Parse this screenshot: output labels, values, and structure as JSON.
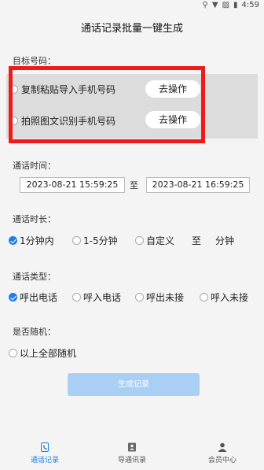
{
  "status_bar": {
    "time": "4:59"
  },
  "title": "通话记录批量一键生成",
  "target": {
    "label": "目标号码：",
    "options": [
      {
        "label": "复制粘贴导入手机号码",
        "button": "去操作"
      },
      {
        "label": "拍照图文识别手机号码",
        "button": "去操作"
      }
    ]
  },
  "time_section": {
    "label": "通话时间：",
    "start": "2023-08-21 15:59:25",
    "separator": "至",
    "end": "2023-08-21 16:59:25"
  },
  "duration": {
    "label": "通话时长：",
    "options": [
      "1分钟内",
      "1-5分钟",
      "自定义"
    ],
    "custom_to": "至",
    "custom_unit": "分钟",
    "selected": 0
  },
  "call_type": {
    "label": "通话类型：",
    "options": [
      "呼出电话",
      "呼入电话",
      "呼出未接",
      "呼入未接"
    ],
    "selected": 0
  },
  "random": {
    "label": "是否随机：",
    "option": "以上全部随机"
  },
  "generate_button": "生成记录",
  "tabs": [
    {
      "label": "通话记录",
      "icon": "phone-icon",
      "active": true
    },
    {
      "label": "导通讯录",
      "icon": "contacts-icon",
      "active": false
    },
    {
      "label": "会员中心",
      "icon": "person-icon",
      "active": false
    }
  ],
  "colors": {
    "accent": "#1f7fe8",
    "highlight_frame": "#ef1b1b",
    "generate_button": "#aacff5"
  }
}
